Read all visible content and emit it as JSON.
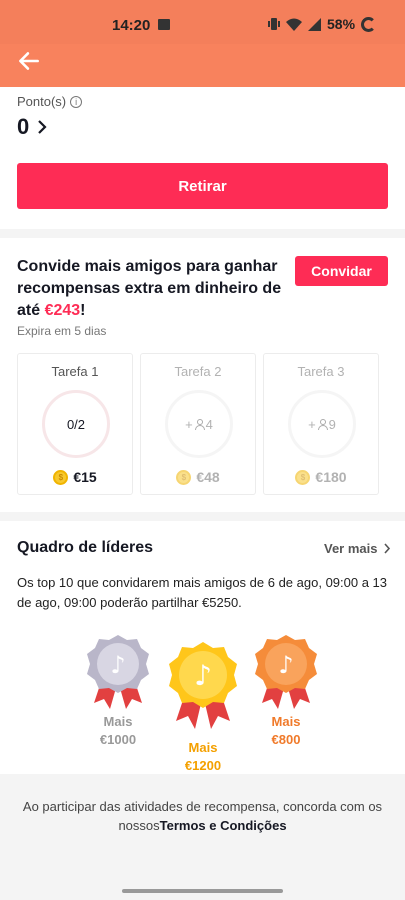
{
  "status": {
    "time": "14:20",
    "battery": "58%"
  },
  "points": {
    "label": "Ponto(s)",
    "value": "0"
  },
  "withdraw_label": "Retirar",
  "invite": {
    "title_prefix": "Convide mais amigos para ganhar recompensas extra em dinheiro de até ",
    "amount": "€243",
    "title_suffix": "!",
    "button": "Convidar",
    "expires": "Expira em 5 dias"
  },
  "tasks": [
    {
      "label": "Tarefa 1",
      "progress": "0/2",
      "reward": "€15"
    },
    {
      "label": "Tarefa 2",
      "progress": "+4",
      "reward": "€48"
    },
    {
      "label": "Tarefa 3",
      "progress": "+9",
      "reward": "€180"
    }
  ],
  "leaderboard": {
    "title": "Quadro de líderes",
    "see_more": "Ver mais",
    "description": "Os top 10 que convidarem mais amigos de 6 de ago, 09:00 a 13 de ago, 09:00 poderão partilhar €5250.",
    "medals": [
      {
        "line1": "Mais",
        "line2": "€1000",
        "color": "#b9b6c9"
      },
      {
        "line1": "Mais",
        "line2": "€1200",
        "color": "#ffc61a"
      },
      {
        "line1": "Mais",
        "line2": "€800",
        "color": "#f58c3a"
      }
    ]
  },
  "footer": {
    "text": "Ao participar das atividades de recompensa, concorda com os nossos",
    "terms": "Termos e Condições"
  },
  "colors": {
    "accent": "#fe2c55",
    "header": "#f8825d"
  },
  "icons": [
    "back-arrow-icon",
    "info-icon",
    "chevron-right-icon",
    "coin-icon",
    "person-icon",
    "tiktok-note-icon",
    "medal-icon"
  ]
}
